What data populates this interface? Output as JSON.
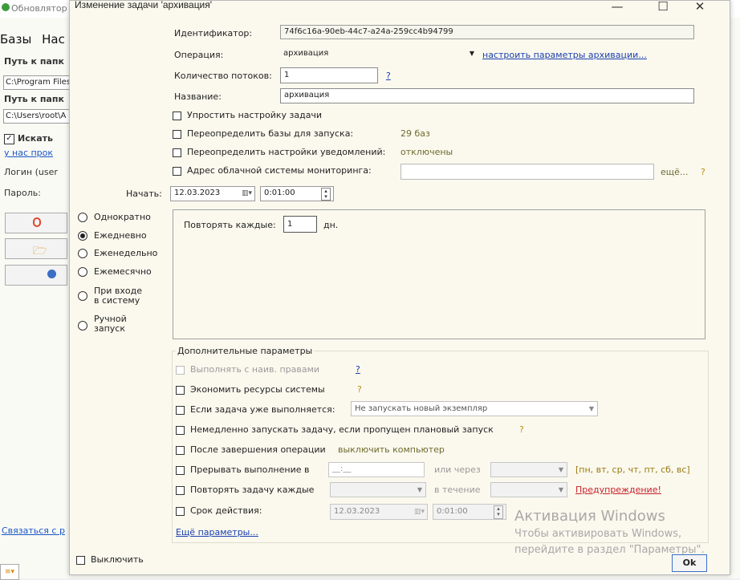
{
  "background": {
    "title": "Обновлятор",
    "tabs": [
      "Базы",
      "Нас"
    ],
    "path_label_1": "Путь к папк",
    "path_value_1": "C:\\Program Files",
    "path_label_2": "Путь к папк",
    "path_value_2": "C:\\Users\\root\\A",
    "search_label": "Искать",
    "our_link": "у нас прок",
    "login_label": "Логин (user",
    "password_label": "Пароль:",
    "contact_link": "Связаться с р"
  },
  "dialog": {
    "title": "Изменение задачи 'архивация'",
    "window_buttons": {
      "minimize": "—",
      "maximize": "☐",
      "close": "✕"
    },
    "identifier_label": "Идентификатор:",
    "identifier_value": "74f6c16a-90eb-44c7-a24a-259cc4b94799",
    "operation_label": "Операция:",
    "operation_value": "архивация",
    "operation_link": "настроить параметры архивации...",
    "threads_label": "Количество потоков:",
    "threads_value": "1",
    "threads_help": "?",
    "name_label": "Название:",
    "name_value": "архивация",
    "simplify_label": "Упростить настройку задачи",
    "override_bases_label": "Переопределить базы для запуска:",
    "override_bases_value": "29 баз",
    "override_notify_label": "Переопределить настройки уведомлений:",
    "override_notify_value": "отключены",
    "cloud_label": "Адрес облачной системы мониторинга:",
    "cloud_value": "",
    "cloud_more": "ещё...",
    "cloud_help": "?",
    "start_label": "Начать:",
    "start_date": "12.03.2023",
    "start_time": "0:01:00",
    "schedule": [
      {
        "label": "Однократно",
        "selected": false
      },
      {
        "label": "Ежедневно",
        "selected": true
      },
      {
        "label": "Еженедельно",
        "selected": false
      },
      {
        "label": "Ежемесячно",
        "selected": false
      },
      {
        "label": "При входе\nв систему",
        "selected": false
      },
      {
        "label": "Ручной\nзапуск",
        "selected": false
      }
    ],
    "repeat_every_label": "Повторять каждые:",
    "repeat_every_value": "1",
    "repeat_every_unit": "дн.",
    "extra_group_title": "Дополнительные параметры",
    "run_elevated_label": "Выполнять с наив. правами",
    "run_elevated_help": "?",
    "save_resources_label": "Экономить ресурсы системы",
    "save_resources_help": "?",
    "if_running_label": "Если задача уже выполняется:",
    "if_running_value": "Не запускать новый экземпляр",
    "run_missed_label": "Немедленно запускать задачу, если пропущен плановый запуск",
    "run_missed_help": "?",
    "after_complete_label": "После завершения операции",
    "after_complete_value": "выключить компьютер",
    "interrupt_label": "Прерывать выполнение в",
    "interrupt_time_placeholder": "__:__",
    "interrupt_or_after": "или через",
    "interrupt_days": "[пн, вт, ср, чт, пт, сб, вс]",
    "repeat_task_label": "Повторять задачу каждые",
    "repeat_task_during": "в течение",
    "warning_link": "Предупреждение!",
    "expiry_label": "Срок действия:",
    "expiry_date": "12.03.2023",
    "expiry_time": "0:01:00",
    "more_params_link": "Ещё параметры...",
    "disable_label": "Выключить",
    "ok_label": "Ok"
  },
  "watermark": {
    "line1": "Активация Windows",
    "line2": "Чтобы активировать Windows,",
    "line3": "перейдите в раздел \"Параметры\"."
  }
}
